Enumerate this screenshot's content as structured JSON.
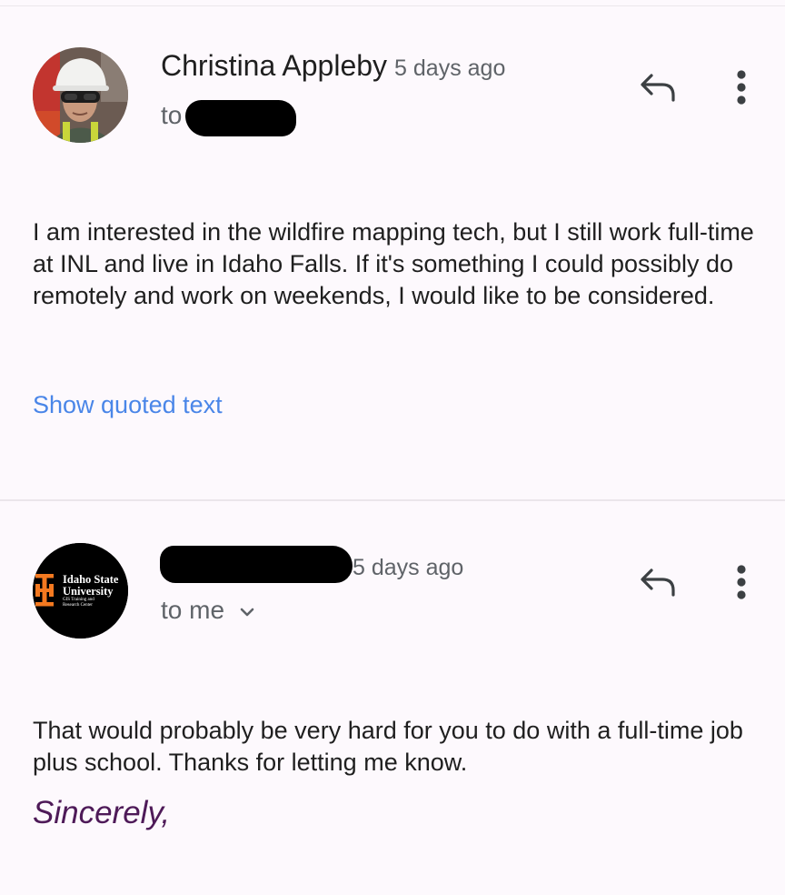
{
  "messages": [
    {
      "sender": "Christina Appleby",
      "time": "5 days ago",
      "recipient_prefix": "to",
      "body": "I am interested in the wildfire mapping tech, but I still work full-time at INL and live in Idaho Falls. If it's something I could possibly do remotely and work on weekends, I would like to be considered.",
      "show_quoted_label": "Show quoted text",
      "avatar_icon": "person-photo-hardhat",
      "reply_icon": "reply-arrow-icon",
      "more_icon": "more-vert-icon"
    },
    {
      "sender": "",
      "time": "5 days ago",
      "recipient": "to me",
      "recipient_chevron": "chevron-down-icon",
      "body": "That would probably be very hard for you to do with a full-time job plus school.  Thanks for letting me know.",
      "signoff": "Sincerely,",
      "avatar": {
        "line1": "Idaho State",
        "line2": "University",
        "line3": "GIS Training and",
        "line4": "Research Center"
      },
      "reply_icon": "reply-arrow-icon",
      "more_icon": "more-vert-icon"
    }
  ],
  "colors": {
    "background": "#fdf9fd",
    "link": "#4a86e8",
    "signoff": "#4e1a58",
    "isu_orange": "#f47920"
  }
}
